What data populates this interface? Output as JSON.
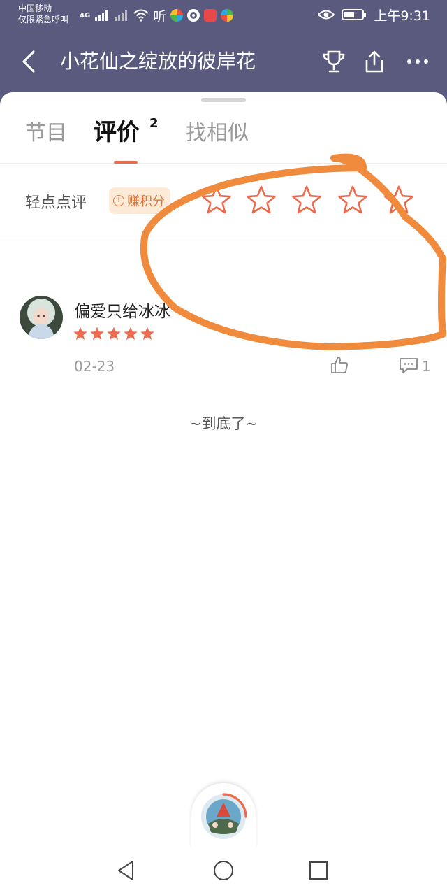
{
  "status": {
    "carrier_line1": "中国移动",
    "carrier_line2": "仅限紧急呼叫",
    "network": "4G",
    "listen_app": "听",
    "time": "上午9:31"
  },
  "nav": {
    "title": "小花仙之绽放的彼岸花",
    "icons": [
      "back-icon",
      "trophy-icon",
      "share-icon",
      "more-icon"
    ]
  },
  "tabs": [
    {
      "label": "节目",
      "active": false
    },
    {
      "label": "评价",
      "active": true,
      "count": "2"
    },
    {
      "label": "找相似",
      "active": false
    }
  ],
  "rating": {
    "label": "轻点点评",
    "earn_badge": "赚积分",
    "star_count": 5
  },
  "reviews": [
    {
      "username": "偏爱只给冰冰",
      "stars": 5,
      "date": "02-23",
      "comment_count": "1"
    }
  ],
  "list_end": "~到底了~",
  "colors": {
    "header_bg": "#5a5a7e",
    "accent": "#ec6b4e",
    "star_outline": "#ec6b4e",
    "annotation_stroke": "#f08a3c"
  }
}
